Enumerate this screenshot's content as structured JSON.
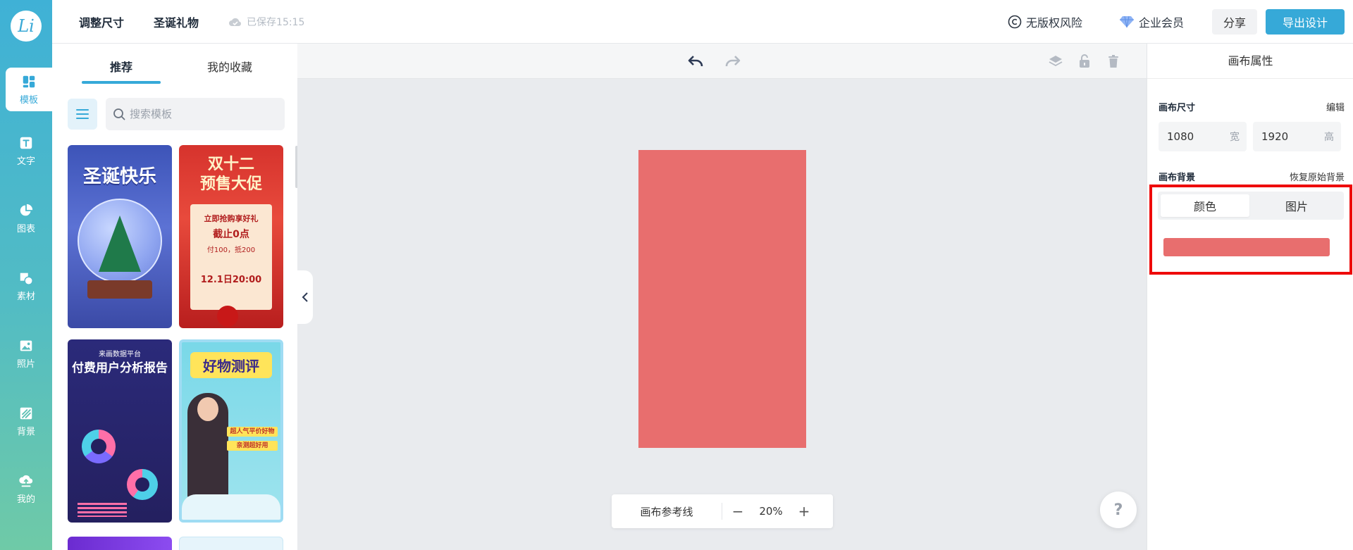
{
  "app": {
    "logo": "Li",
    "topbar": {
      "resize_label": "调整尺寸",
      "doc_title": "圣诞礼物",
      "saved_status": "已保存15:15",
      "copyright_label": "无版权风险",
      "vip_label": "企业会员",
      "share_label": "分享",
      "export_label": "导出设计"
    },
    "rail": {
      "items": [
        {
          "label": "模板",
          "icon": "template-icon"
        },
        {
          "label": "文字",
          "icon": "text-icon"
        },
        {
          "label": "图表",
          "icon": "chart-icon"
        },
        {
          "label": "素材",
          "icon": "material-icon"
        },
        {
          "label": "照片",
          "icon": "photo-icon"
        },
        {
          "label": "背景",
          "icon": "background-icon"
        },
        {
          "label": "我的",
          "icon": "upload-icon"
        }
      ]
    },
    "templates": {
      "tabs": [
        {
          "label": "推荐"
        },
        {
          "label": "我的收藏"
        }
      ],
      "search_placeholder": "搜索模板",
      "cards": [
        {
          "title": "圣诞快乐"
        },
        {
          "title": "双十二\n预售大促",
          "line1": "立即抢购享好礼",
          "line2": "截止0点",
          "line3": "付100，抵200",
          "line4": "12.1日20:00"
        },
        {
          "subtitle": "来画数据平台",
          "title": "付费用户分析报告"
        },
        {
          "title": "好物测评",
          "tag1": "超人气平价好物",
          "tag2": "亲测超好用"
        }
      ]
    },
    "canvas": {
      "fill_color": "#e86e6e",
      "zoom": "20%",
      "guide_label": "画布参考线",
      "help_label": "?"
    },
    "properties": {
      "title": "画布属性",
      "size_label": "画布尺寸",
      "edit_label": "编辑",
      "width_value": "1080",
      "width_unit": "宽",
      "height_value": "1920",
      "height_unit": "高",
      "bg_label": "画布背景",
      "reset_label": "恢复原始背景",
      "bg_tabs": [
        {
          "label": "颜色"
        },
        {
          "label": "图片"
        }
      ],
      "bg_color": "#e86e6e"
    },
    "colors": {
      "accent": "#36a9d8",
      "highlight_border": "#ee0a0a"
    }
  }
}
